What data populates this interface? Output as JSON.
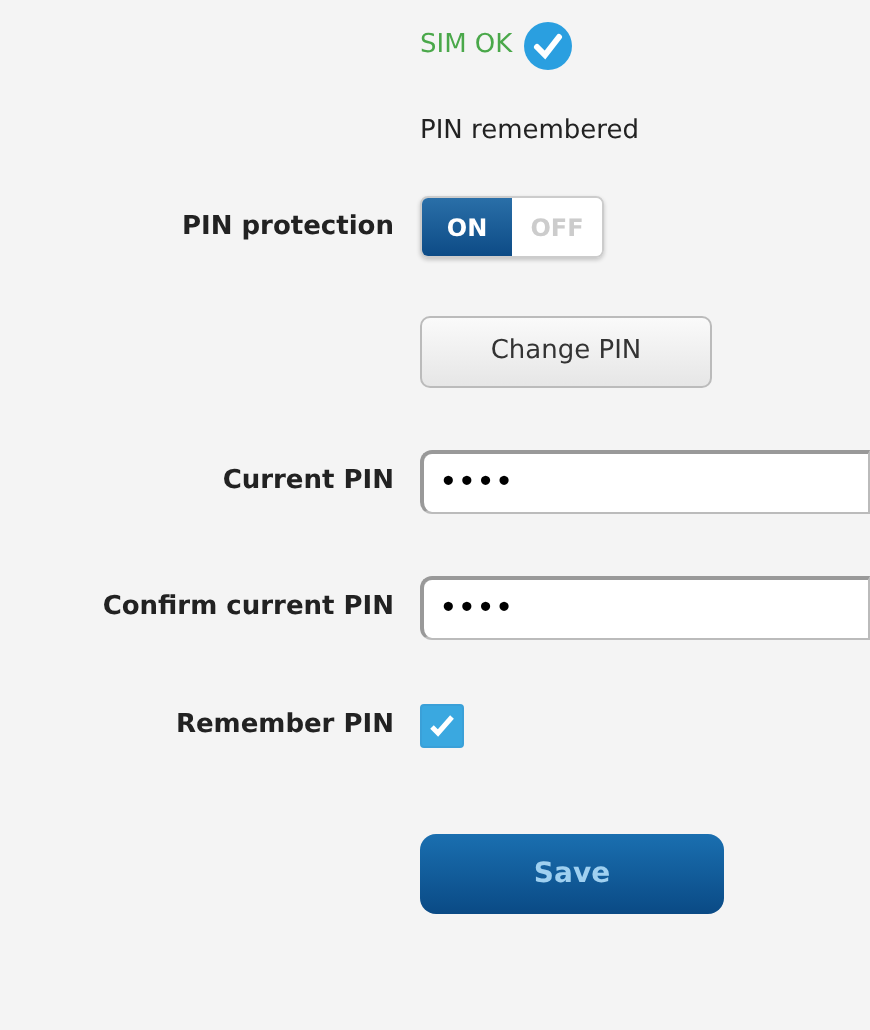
{
  "sim_status": {
    "text": "SIM OK",
    "ok": true
  },
  "pin_status": "PIN remembered",
  "pin_protection": {
    "label": "PIN protection",
    "options": [
      {
        "label": "ON",
        "selected": true
      },
      {
        "label": "OFF",
        "selected": false
      }
    ]
  },
  "change_pin_button": "Change PIN",
  "fields": [
    {
      "label": "Current PIN",
      "value": "••••"
    },
    {
      "label": "Confirm current PIN",
      "value": "••••"
    }
  ],
  "remember_pin": {
    "label": "Remember PIN",
    "checked": true
  },
  "save_button": "Save"
}
